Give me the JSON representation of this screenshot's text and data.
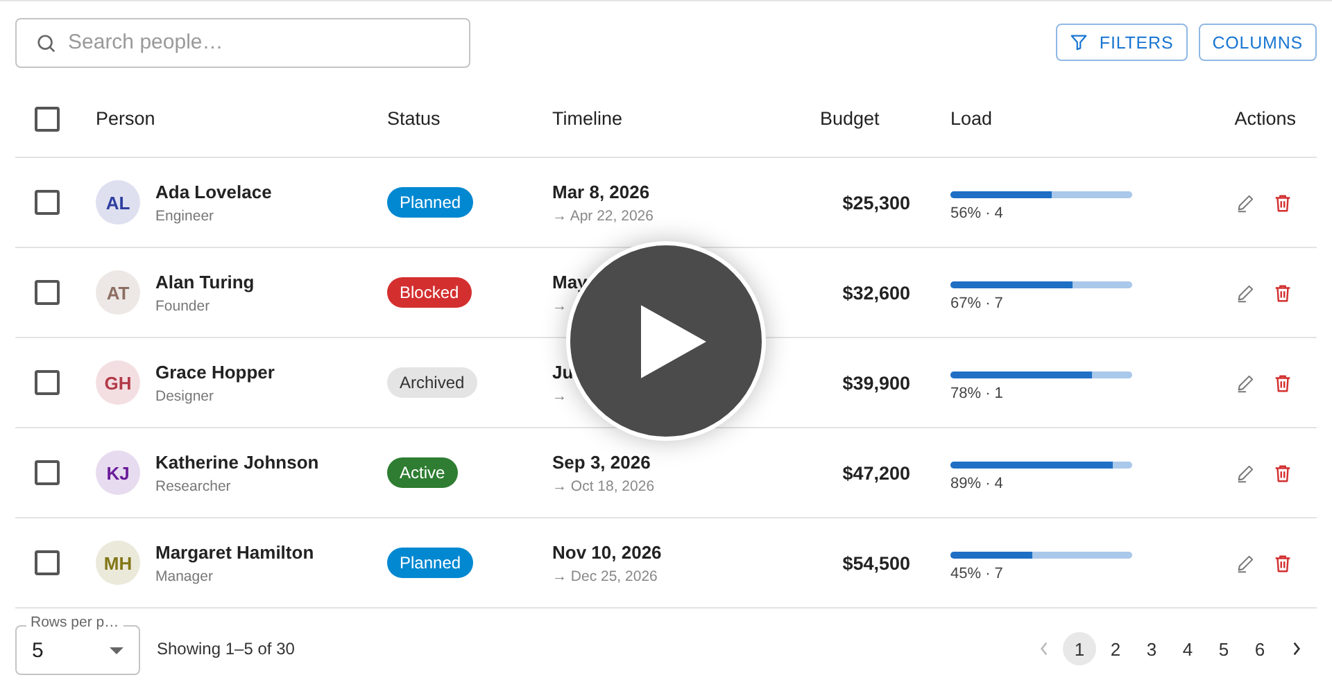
{
  "search": {
    "placeholder": "Search people…"
  },
  "toolbar_buttons": [
    {
      "label": "FILTERS",
      "kind": "filter"
    },
    {
      "label": "COLUMNS",
      "kind": "plain"
    }
  ],
  "table": {
    "select_all": {
      "checked": false
    },
    "columns": [
      "Person",
      "Status",
      "Timeline",
      "Budget",
      "Load",
      "Actions"
    ],
    "rows": [
      {
        "checked": false,
        "initials": "AL",
        "color": "#303f9f",
        "name": "Ada Lovelace",
        "role": "Engineer",
        "status": {
          "label": "Planned",
          "color": "#0288d1"
        },
        "start": "Mar 8, 2026",
        "end": "→ Apr 22, 2026",
        "budget": "$25,300",
        "level": 0.56,
        "load": "56% · 4"
      },
      {
        "checked": false,
        "initials": "AT",
        "color": "#8d6e63",
        "name": "Alan Turing",
        "role": "Founder",
        "status": {
          "label": "Blocked",
          "color": "#d32f2f"
        },
        "start": "May",
        "end": "→",
        "budget": "$32,600",
        "level": 0.67,
        "load": "67% · 7"
      },
      {
        "checked": false,
        "initials": "GH",
        "color": "#b23a48",
        "name": "Grace Hopper",
        "role": "Designer",
        "status": {
          "label": "Archived",
          "color": "#e4e4e4"
        },
        "start": "Ju",
        "end": "→",
        "budget": "$39,900",
        "level": 0.78,
        "load": "78% · 1"
      },
      {
        "checked": false,
        "initials": "KJ",
        "color": "#6a1b9a",
        "name": "Katherine Johnson",
        "role": "Researcher",
        "status": {
          "label": "Active",
          "color": "#2e7d32"
        },
        "start": "Sep 3, 2026",
        "end": "→ Oct 18, 2026",
        "budget": "$47,200",
        "level": 0.89,
        "load": "89% · 4"
      },
      {
        "checked": false,
        "initials": "MH",
        "color": "#827717",
        "name": "Margaret Hamilton",
        "role": "Manager",
        "status": {
          "label": "Planned",
          "color": "#0288d1"
        },
        "start": "Nov 10, 2026",
        "end": "→ Dec 25, 2026",
        "budget": "$54,500",
        "level": 0.45,
        "load": "45% · 7"
      }
    ]
  },
  "footer": {
    "rows_per_page": {
      "label": "Rows per p…",
      "value": "5"
    },
    "showing": "Showing 1–5 of 30",
    "pages": [
      {
        "label": "1",
        "selected": true
      },
      {
        "label": "2",
        "selected": false
      },
      {
        "label": "3",
        "selected": false
      },
      {
        "label": "4",
        "selected": false
      },
      {
        "label": "5",
        "selected": false
      },
      {
        "label": "6",
        "selected": false
      }
    ]
  },
  "video_overlay": {
    "kind": "play"
  }
}
